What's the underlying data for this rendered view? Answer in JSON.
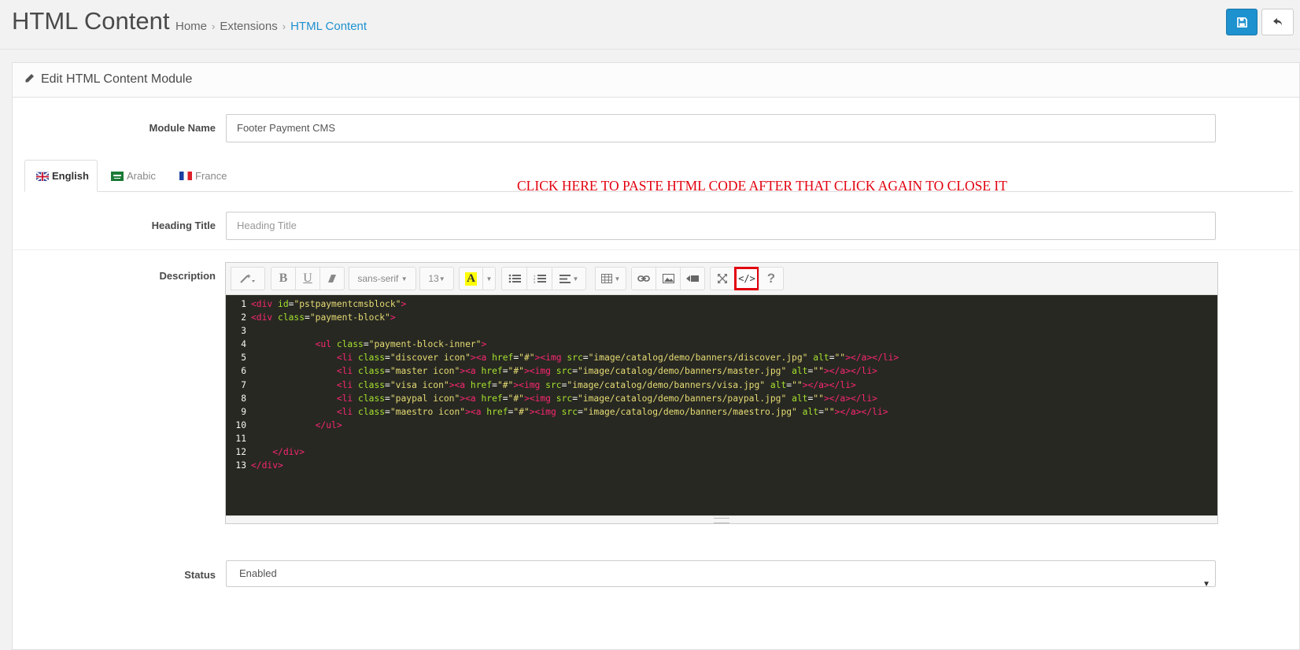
{
  "header": {
    "title": "HTML Content",
    "breadcrumb": [
      "Home",
      "Extensions",
      "HTML Content"
    ],
    "save_icon": "save-icon",
    "back_icon": "reply-icon"
  },
  "panel": {
    "title": "Edit HTML Content Module",
    "icon": "pencil-icon"
  },
  "form": {
    "module_name_label": "Module Name",
    "module_name_value": "Footer Payment CMS",
    "tabs": [
      {
        "label": "English",
        "flag": "uk-flag-icon",
        "active": true
      },
      {
        "label": "Arabic",
        "flag": "sa-flag-icon",
        "active": false
      },
      {
        "label": "France",
        "flag": "fr-flag-icon",
        "active": false
      }
    ],
    "heading_title_label": "Heading Title",
    "heading_title_placeholder": "Heading Title",
    "description_label": "Description",
    "status_label": "Status",
    "status_value": "Enabled"
  },
  "toolbar": {
    "font_family": "sans-serif",
    "font_size": "13",
    "bold": "B",
    "underline": "U",
    "code_view": "</>",
    "help": "?"
  },
  "annotation": "CLICK HERE TO PASTE HTML CODE AFTER THAT CLICK AGAIN TO CLOSE IT",
  "code": {
    "line_numbers": [
      "1",
      "2",
      "3",
      "4",
      "5",
      "6",
      "7",
      "8",
      "9",
      "10",
      "11",
      "12",
      "13"
    ],
    "lines": [
      "<div id=\"pstpaymentcmsblock\">",
      "<div class=\"payment-block\">",
      "",
      "            <ul class=\"payment-block-inner\">",
      "                <li class=\"discover icon\"><a href=\"#\"><img src=\"image/catalog/demo/banners/discover.jpg\" alt=\"\"></a></li>",
      "                <li class=\"master icon\"><a href=\"#\"><img src=\"image/catalog/demo/banners/master.jpg\" alt=\"\"></a></li>",
      "                <li class=\"visa icon\"><a href=\"#\"><img src=\"image/catalog/demo/banners/visa.jpg\" alt=\"\"></a></li>",
      "                <li class=\"paypal icon\"><a href=\"#\"><img src=\"image/catalog/demo/banners/paypal.jpg\" alt=\"\"></a></li>",
      "                <li class=\"maestro icon\"><a href=\"#\"><img src=\"image/catalog/demo/banners/maestro.jpg\" alt=\"\"></a></li>",
      "            </ul>",
      "",
      "    </div>",
      "</div>"
    ]
  },
  "colors": {
    "primary": "#1e91cf",
    "annotation_red": "#e2000f",
    "editor_bg": "#272822"
  }
}
